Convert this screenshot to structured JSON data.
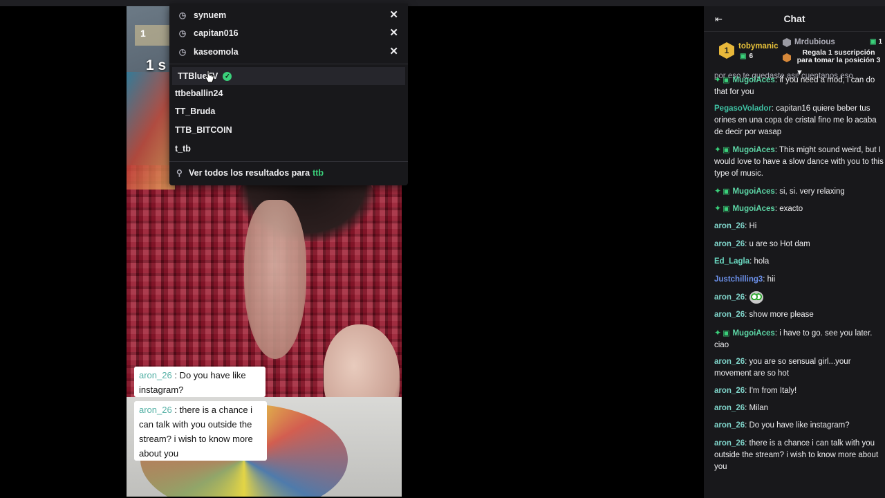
{
  "video": {
    "overlay_number": "1",
    "overlay_text": "1 s",
    "bubbles": [
      {
        "user": "aron_26",
        "text": " : Do you have like instagram?"
      },
      {
        "user": "aron_26",
        "text": " : there is a chance i can talk with you outside the stream? i wish to know more about you"
      }
    ]
  },
  "search_dropdown": {
    "recent": [
      "synuem",
      "capitan016",
      "kaseomola"
    ],
    "results": [
      "TTBlueTV",
      "ttbeballin24",
      "TT_Bruda",
      "TTB_BITCOIN",
      "t_tb"
    ],
    "see_all_label": "Ver todos los resultados para",
    "query": "ttb",
    "icons": {
      "history": "clock-icon",
      "remove": "close-icon",
      "verified": "verified-check-icon",
      "search": "search-icon"
    },
    "colors": {
      "accent": "#3ad07a",
      "background": "#18181b"
    }
  },
  "chat": {
    "title": "Chat",
    "leaderboard": {
      "first": {
        "rank": "1",
        "name": "tobymanic",
        "count": "6"
      },
      "second": {
        "name": "Mrdubious"
      },
      "gift_cta": "Regala 1 suscripción para tomar la posición 3",
      "right_count": "1"
    },
    "partial_line": "por eso te quedaste asi! cuentanos eso",
    "messages": [
      {
        "user": "MugoiAces",
        "color": "#5dd6a6",
        "badges": true,
        "text": ": if you need a mod, i can do that for you"
      },
      {
        "user": "PegasoVolador",
        "color": "#3fc1a3",
        "badges": false,
        "text": ": capitan16 quiere beber tus orines en una copa de cristal fino me lo acaba de decir por wasap"
      },
      {
        "user": "MugoiAces",
        "color": "#5dd6a6",
        "badges": true,
        "text": ": This might sound weird, but I would love to have a slow dance with you to this type of music."
      },
      {
        "user": "MugoiAces",
        "color": "#5dd6a6",
        "badges": true,
        "text": ": si, si. very relaxing"
      },
      {
        "user": "MugoiAces",
        "color": "#5dd6a6",
        "badges": true,
        "text": ": exacto"
      },
      {
        "user": "aron_26",
        "color": "#7fd3c9",
        "badges": false,
        "text": ": Hi"
      },
      {
        "user": "aron_26",
        "color": "#7fd3c9",
        "badges": false,
        "text": ": u are so Hot dam"
      },
      {
        "user": "Ed_Lagla",
        "color": "#6ad7c0",
        "badges": false,
        "text": ": hola"
      },
      {
        "user": "Justchilling3",
        "color": "#6b8fe8",
        "badges": false,
        "text": ": hii"
      },
      {
        "user": "aron_26",
        "color": "#7fd3c9",
        "badges": false,
        "text": ": ",
        "emote": true
      },
      {
        "user": "aron_26",
        "color": "#7fd3c9",
        "badges": false,
        "text": ": show more please"
      },
      {
        "user": "MugoiAces",
        "color": "#5dd6a6",
        "badges": true,
        "text": ": i have to go. see you later. ciao"
      },
      {
        "user": "aron_26",
        "color": "#7fd3c9",
        "badges": false,
        "text": ": you are so sensual girl...your movement are so hot"
      },
      {
        "user": "aron_26",
        "color": "#7fd3c9",
        "badges": false,
        "text": ": I'm from Italy!"
      },
      {
        "user": "aron_26",
        "color": "#7fd3c9",
        "badges": false,
        "text": ": Milan"
      },
      {
        "user": "aron_26",
        "color": "#7fd3c9",
        "badges": false,
        "text": ": Do you have like instagram?"
      },
      {
        "user": "aron_26",
        "color": "#7fd3c9",
        "badges": false,
        "text": ": there is a chance i can talk with you outside the stream? i wish to know more about you"
      }
    ]
  }
}
